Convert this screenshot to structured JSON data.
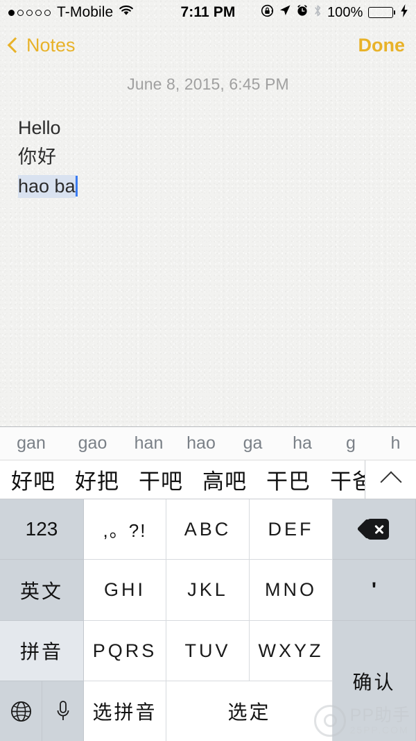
{
  "status_bar": {
    "signal_dots_total": 5,
    "signal_dots_filled": 1,
    "carrier": "T-Mobile",
    "wifi_icon": "wifi-icon",
    "time": "7:11 PM",
    "rotation_lock_icon": "rotation-lock-icon",
    "location_icon": "location-arrow-icon",
    "alarm_icon": "alarm-clock-icon",
    "bluetooth_icon": "bluetooth-icon",
    "battery_percent": "100%",
    "battery_level": 100,
    "battery_color": "#4cd964",
    "charging_icon": "lightning-bolt-icon"
  },
  "nav_bar": {
    "back_label": "Notes",
    "back_icon": "chevron-left-icon",
    "done_label": "Done",
    "tint_color": "#e8b229"
  },
  "note": {
    "date": "June 8, 2015, 6:45 PM",
    "lines": [
      {
        "text": "Hello",
        "composing": false
      },
      {
        "text": "你好",
        "composing": false
      },
      {
        "text": "hao ba",
        "composing": true
      }
    ],
    "caret_color": "#3a7bf0",
    "composing_highlight": "#d9e2f0"
  },
  "keyboard": {
    "pinyin_suggestions": [
      "gan",
      "gao",
      "han",
      "hao",
      "ga",
      "ha",
      "g",
      "h"
    ],
    "candidates": [
      "好吧",
      "好把",
      "干吧",
      "高吧",
      "干巴",
      "干爸"
    ],
    "expand_icon": "chevron-up-icon",
    "keys": {
      "numbers": "123",
      "punctuation": ",。?!",
      "abc": "ABC",
      "def": "DEF",
      "delete_icon": "backspace-delete-icon",
      "english": "英文",
      "ghi": "GHI",
      "jkl": "JKL",
      "mno": "MNO",
      "apostrophe": "'",
      "pinyin": "拼音",
      "pqrs": "PQRS",
      "tuv": "TUV",
      "wxyz": "WXYZ",
      "confirm": "确认",
      "globe_icon": "globe-language-icon",
      "mic_icon": "microphone-icon",
      "choose_pinyin": "选拼音",
      "select": "选定"
    }
  },
  "watermark": {
    "main": "PP助手",
    "sub": "25PP.COM",
    "logo_icon": "pp-logo-icon"
  }
}
